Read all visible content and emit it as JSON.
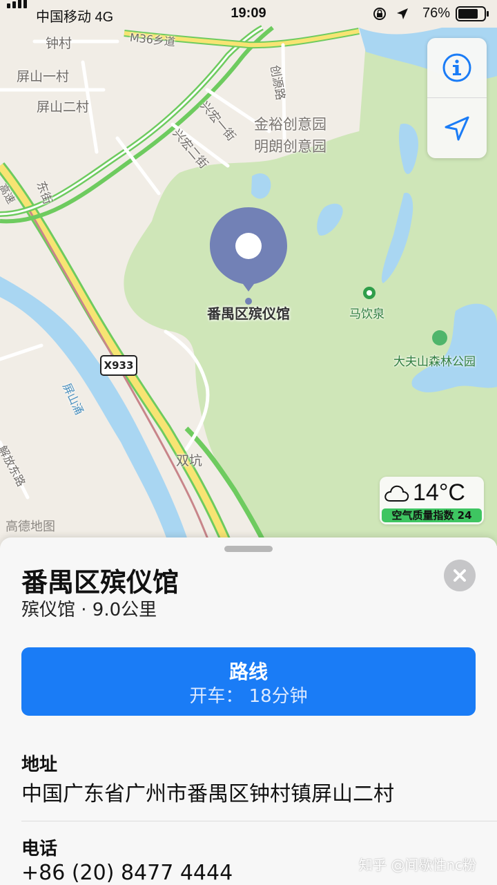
{
  "status_bar": {
    "carrier": "中国移动  4G",
    "time": "19:09",
    "battery": "76%"
  },
  "map": {
    "labels": {
      "zhongcun": "钟村",
      "m36": "M36乡道",
      "pingshan1": "屏山一村",
      "pingshan2": "屏山二村",
      "chuangyuan": "创源路",
      "xinghong1": "兴宏一街",
      "xinghong2": "兴宏二街",
      "jinyu": "金裕创意园",
      "minglang": "明朗创意园",
      "dongjie": "东街",
      "gaosu": "高速",
      "mayinquan": "马饮泉",
      "dafushan": "大夫山森林公园",
      "pingshanyong": "屏山涌",
      "shuangkeng": "双坑",
      "jiefang": "解放东路",
      "gaode": "高德地图"
    },
    "road_shield": "X933",
    "pin_label": "番禺区殡仪馆",
    "weather": {
      "icon": "cloud-icon",
      "temperature": "14°C",
      "aqi": "空气质量指数 24"
    }
  },
  "controls": {
    "info_icon": "info-icon",
    "location_icon": "location-arrow-icon"
  },
  "sheet": {
    "title": "番禺区殡仪馆",
    "subtitle": "殡仪馆 · 9.0公里",
    "route": {
      "label": "路线",
      "sub": "开车： 18分钟"
    },
    "address": {
      "label": "地址",
      "value": "中国广东省广州市番禺区钟村镇屏山二村"
    },
    "phone": {
      "label": "电话",
      "value": "+86 (20) 8477 4444"
    }
  },
  "watermark": "知乎 @间歇性nc粉",
  "colors": {
    "accent": "#1a7cf6",
    "pin": "#7281b6",
    "park": "#cfe6b8",
    "water": "#a9d6f2"
  }
}
